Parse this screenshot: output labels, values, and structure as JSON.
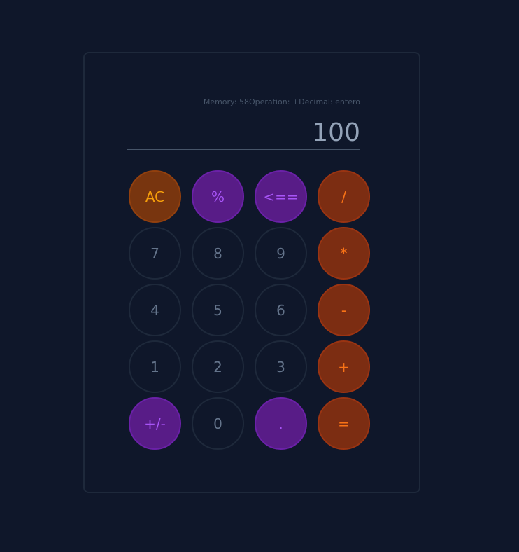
{
  "status": {
    "text": "Memory: 58Operation: +Decimal: entero"
  },
  "display": {
    "value": "100"
  },
  "colors": {
    "background": "#0f172a",
    "clear_key": "#78350f",
    "function_key": "#581c87",
    "operator_key": "#7c2d12"
  },
  "keys": {
    "clear": "AC",
    "percent": "%",
    "backspace": "<==",
    "divide": "/",
    "seven": "7",
    "eight": "8",
    "nine": "9",
    "multiply": "*",
    "four": "4",
    "five": "5",
    "six": "6",
    "subtract": "-",
    "one": "1",
    "two": "2",
    "three": "3",
    "add": "+",
    "sign": "+/-",
    "zero": "0",
    "decimal": ".",
    "equals": "="
  }
}
